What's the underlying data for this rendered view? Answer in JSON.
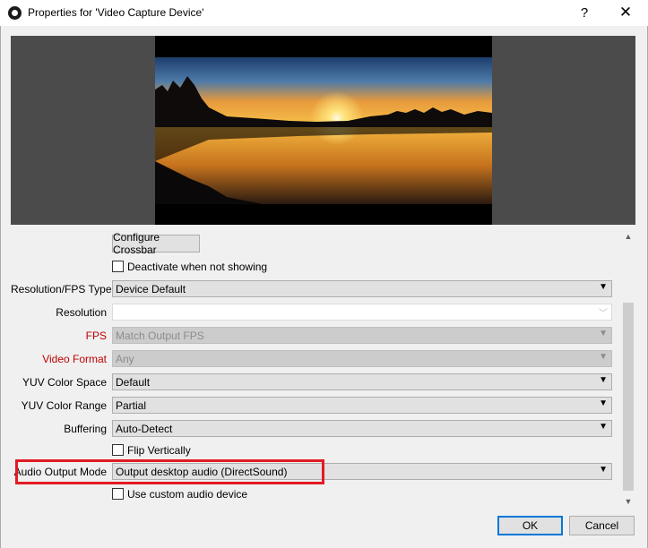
{
  "window": {
    "title": "Properties for 'Video Capture Device'",
    "help_label": "?",
    "close_label": "✕"
  },
  "preview": {
    "description_icon": "sunset-lake-video-preview"
  },
  "form": {
    "configure_crossbar": "Configure Crossbar",
    "deactivate_label": "Deactivate when not showing",
    "resolution_fps_type": {
      "label": "Resolution/FPS Type",
      "value": "Device Default"
    },
    "resolution": {
      "label": "Resolution",
      "value": ""
    },
    "fps": {
      "label": "FPS",
      "value": "Match Output FPS"
    },
    "video_format": {
      "label": "Video Format",
      "value": "Any"
    },
    "yuv_color_space": {
      "label": "YUV Color Space",
      "value": "Default"
    },
    "yuv_color_range": {
      "label": "YUV Color Range",
      "value": "Partial"
    },
    "buffering": {
      "label": "Buffering",
      "value": "Auto-Detect"
    },
    "flip_vertically_label": "Flip Vertically",
    "audio_output_mode": {
      "label": "Audio Output Mode",
      "value": "Output desktop audio (DirectSound)"
    },
    "custom_audio_label": "Use custom audio device"
  },
  "buttons": {
    "ok": "OK",
    "cancel": "Cancel"
  },
  "colors": {
    "highlight": "#e21b23",
    "disabled_label": "#c00000"
  }
}
